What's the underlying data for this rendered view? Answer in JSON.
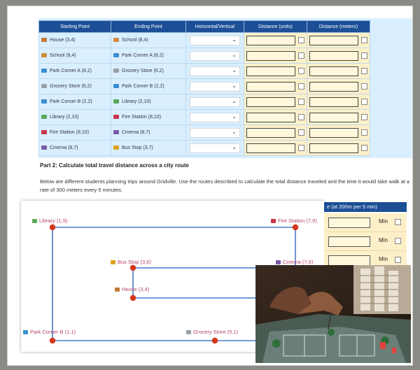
{
  "table": {
    "headers": [
      "Starting Point",
      "Ending Point",
      "Horizontal/Vertical",
      "Distance (units)",
      "Distance (meters)"
    ],
    "rows": [
      {
        "start": "House (3,4)",
        "start_icon": "house-icon",
        "end": "School (8,4)",
        "end_icon": "school-icon",
        "direction": ""
      },
      {
        "start": "School (8,4)",
        "start_icon": "school-icon",
        "end": "Park Corner A (8,2)",
        "end_icon": "park-icon",
        "direction": ""
      },
      {
        "start": "Park Corner A (8,2)",
        "start_icon": "park-icon",
        "end": "Grocery Store (6,2)",
        "end_icon": "cart-icon",
        "direction": ""
      },
      {
        "start": "Grocery Store (6,2)",
        "start_icon": "cart-icon",
        "end": "Park Corner B (2,2)",
        "end_icon": "park-icon",
        "direction": ""
      },
      {
        "start": "Park Corner B (2,2)",
        "start_icon": "park-icon",
        "end": "Library (2,10)",
        "end_icon": "books-icon",
        "direction": ""
      },
      {
        "start": "Library (2,10)",
        "start_icon": "books-icon",
        "end": "Fire Station (8,10)",
        "end_icon": "fire-truck-icon",
        "direction": ""
      },
      {
        "start": "Fire Station (8,10)",
        "start_icon": "fire-truck-icon",
        "end": "Cinema (8,7)",
        "end_icon": "film-icon",
        "direction": ""
      },
      {
        "start": "Cinema (8,7)",
        "start_icon": "film-icon",
        "end": "Bus Stop (3,7)",
        "end_icon": "bus-icon",
        "direction": ""
      }
    ]
  },
  "part2": {
    "heading": "Part 2: Calculate total travel distance across a city route",
    "description": "Below are different students planning trips around Gridville. Use the routes described to calculate the total distance traveled and the time it would take walk at a rate of 300 meters every 5 minutes."
  },
  "map": {
    "labels": {
      "library": "Library (1,9)",
      "fire_station": "Fire Station (7,9)",
      "bus_stop": "Bus Stop (3,6)",
      "cinema": "Cinema (7,6)",
      "house": "House (3,4)",
      "park_corner_b": "Park Corner B (1,1)",
      "grocery": "Grocery Store (5,1)"
    },
    "line_color": "#4a78c8",
    "dot_color": "#d6361c"
  },
  "time_panel": {
    "header": "e (at 200m per 5 min)",
    "unit": "Min",
    "rows": 3
  },
  "colors": {
    "header_bg": "#1c4f96",
    "table_bg": "#d9efff",
    "input_bg": "#fdf0c8",
    "label_pink": "#b5466b"
  }
}
